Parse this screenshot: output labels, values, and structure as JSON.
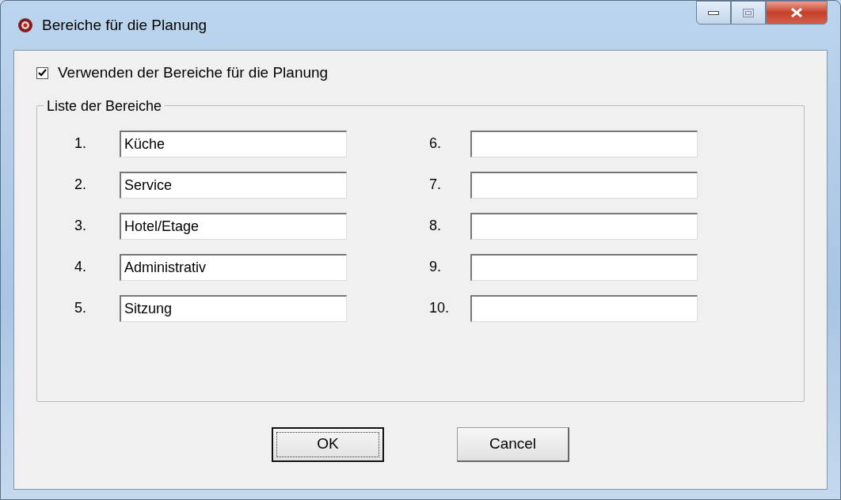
{
  "window": {
    "title": "Bereiche für die Planung"
  },
  "use_areas": {
    "label": "Verwenden der Bereiche für die Planung",
    "checked": true
  },
  "group": {
    "title": "Liste der Bereiche",
    "fields": [
      {
        "number": "1.",
        "value": "Küche"
      },
      {
        "number": "2.",
        "value": "Service"
      },
      {
        "number": "3.",
        "value": "Hotel/Etage"
      },
      {
        "number": "4.",
        "value": "Administrativ"
      },
      {
        "number": "5.",
        "value": "Sitzung"
      },
      {
        "number": "6."
      },
      {
        "number": "7."
      },
      {
        "number": "8."
      },
      {
        "number": "9."
      },
      {
        "number": "10."
      }
    ]
  },
  "buttons": [
    {
      "label": "OK",
      "default": true
    },
    {
      "label": "Cancel",
      "default": false
    }
  ]
}
